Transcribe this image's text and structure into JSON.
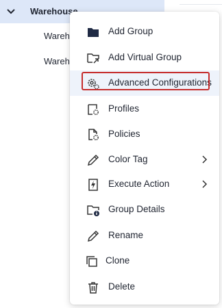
{
  "tree": {
    "root_label": "Warehouse",
    "children": [
      "Warehouse",
      "Warehouse"
    ]
  },
  "menu": {
    "items": [
      {
        "label": "Add Group",
        "icon": "folder-icon"
      },
      {
        "label": "Add Virtual Group",
        "icon": "folder-arrow-icon"
      },
      {
        "label": "Advanced Configurations",
        "icon": "gears-icon"
      },
      {
        "label": "Profiles",
        "icon": "profile-gear-icon"
      },
      {
        "label": "Policies",
        "icon": "document-gear-icon"
      },
      {
        "label": "Color Tag",
        "icon": "pencil-icon"
      },
      {
        "label": "Execute Action",
        "icon": "lightning-icon"
      },
      {
        "label": "Group Details",
        "icon": "folder-info-icon"
      },
      {
        "label": "Rename",
        "icon": "pencil-icon"
      },
      {
        "label": "Clone",
        "icon": "clone-icon"
      },
      {
        "label": "Delete",
        "icon": "trash-icon"
      }
    ]
  },
  "colors": {
    "selection": "#dde7f8",
    "hover": "#eef3fb",
    "focus_border": "#c52b2b"
  }
}
